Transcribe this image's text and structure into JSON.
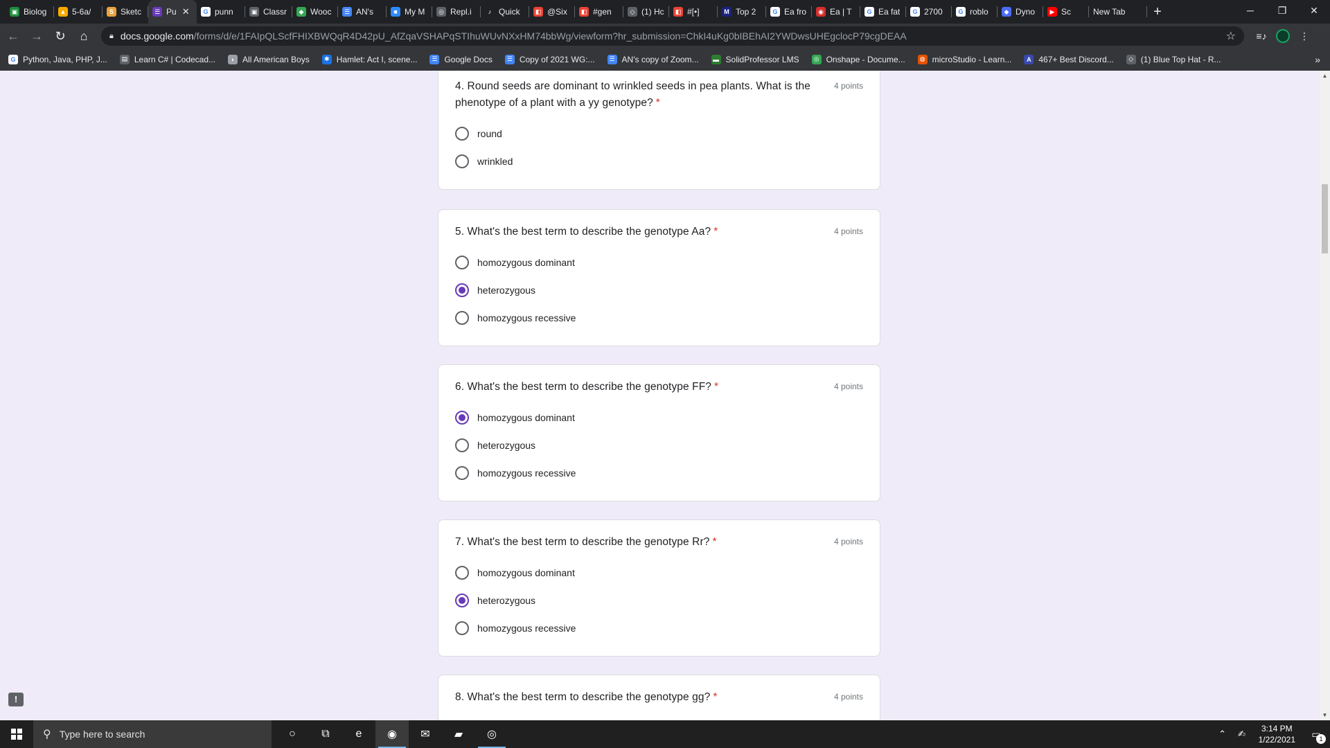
{
  "tabs": [
    {
      "title": "Biolog",
      "fav_color": "#1e8e3e",
      "fav_glyph": "▣"
    },
    {
      "title": "5-6a/",
      "fav_color": "#f9ab00",
      "fav_glyph": "▲"
    },
    {
      "title": "Sketc",
      "fav_color": "#e8a33d",
      "fav_glyph": "S"
    },
    {
      "title": "Pu",
      "fav_color": "#673ab7",
      "fav_glyph": "☰",
      "active": true
    },
    {
      "title": "punn",
      "fav_color": "#ffffff",
      "fav_glyph": "G"
    },
    {
      "title": "Classr",
      "fav_color": "#5f6368",
      "fav_glyph": "▣"
    },
    {
      "title": "Wooc",
      "fav_color": "#34a853",
      "fav_glyph": "◆"
    },
    {
      "title": "AN's",
      "fav_color": "#4285f4",
      "fav_glyph": "☰"
    },
    {
      "title": "My M",
      "fav_color": "#2d8cff",
      "fav_glyph": "■"
    },
    {
      "title": "Repl.i",
      "fav_color": "#5f6368",
      "fav_glyph": "◎"
    },
    {
      "title": "Quick",
      "fav_color": "#202124",
      "fav_glyph": "♪"
    },
    {
      "title": "@Six",
      "fav_color": "#ea4335",
      "fav_glyph": "◧"
    },
    {
      "title": "#gen",
      "fav_color": "#ea4335",
      "fav_glyph": "◧"
    },
    {
      "title": "(1) Hc",
      "fav_color": "#5f6368",
      "fav_glyph": "◇"
    },
    {
      "title": "#[•]",
      "fav_color": "#ea4335",
      "fav_glyph": "◧"
    },
    {
      "title": "Top 2",
      "fav_color": "#1a237e",
      "fav_glyph": "M"
    },
    {
      "title": "Ea fro",
      "fav_color": "#ffffff",
      "fav_glyph": "G"
    },
    {
      "title": "Ea | T",
      "fav_color": "#d32f2f",
      "fav_glyph": "◉"
    },
    {
      "title": "Ea fat",
      "fav_color": "#ffffff",
      "fav_glyph": "G"
    },
    {
      "title": "2700",
      "fav_color": "#ffffff",
      "fav_glyph": "G"
    },
    {
      "title": "roblo",
      "fav_color": "#ffffff",
      "fav_glyph": "G"
    },
    {
      "title": "Dyno",
      "fav_color": "#4a6cf7",
      "fav_glyph": "◆"
    },
    {
      "title": "Sc",
      "fav_color": "#ff0000",
      "fav_glyph": "▶"
    },
    {
      "title": "New Tab",
      "fav_color": "",
      "fav_glyph": ""
    }
  ],
  "window_controls": {
    "minimize": "─",
    "restore": "❐",
    "close": "✕"
  },
  "toolbar": {
    "url_domain": "docs.google.com",
    "url_path": "/forms/d/e/1FAIpQLScfFHIXBWQqR4D42pU_AfZqaVSHAPqSTIhuWUvNXxHM74bbWg/viewform?hr_submission=ChkI4uKg0bIBEhAI2YWDwsUHEgclocP79cgDEAA"
  },
  "bookmarks": [
    {
      "label": "Python, Java, PHP, J...",
      "color": "#ffffff",
      "glyph": "G"
    },
    {
      "label": "Learn C# | Codecad...",
      "color": "#5f6368",
      "glyph": "▤"
    },
    {
      "label": "All American Boys",
      "color": "#9aa0a6",
      "glyph": "◗"
    },
    {
      "label": "Hamlet: Act I, scene...",
      "color": "#1a73e8",
      "glyph": "✱"
    },
    {
      "label": "Google Docs",
      "color": "#4285f4",
      "glyph": "☰"
    },
    {
      "label": "Copy of 2021 WG:...",
      "color": "#4285f4",
      "glyph": "☰"
    },
    {
      "label": "AN's copy of Zoom...",
      "color": "#4285f4",
      "glyph": "☰"
    },
    {
      "label": "SolidProfessor LMS",
      "color": "#2e7d32",
      "glyph": "▬"
    },
    {
      "label": "Onshape - Docume...",
      "color": "#34a853",
      "glyph": "◎"
    },
    {
      "label": "microStudio - Learn...",
      "color": "#e65100",
      "glyph": "◍"
    },
    {
      "label": "467+ Best Discord...",
      "color": "#3949ab",
      "glyph": "A"
    },
    {
      "label": "(1) Blue Top Hat - R...",
      "color": "#5f6368",
      "glyph": "◇"
    }
  ],
  "questions": [
    {
      "title": "4. Round seeds are dominant to wrinkled seeds in pea plants. What is the phenotype of a plant with a yy genotype?",
      "points": "4 points",
      "required_mark": "*",
      "options": [
        {
          "label": "round",
          "checked": false
        },
        {
          "label": "wrinkled",
          "checked": false
        }
      ]
    },
    {
      "title": "5. What's the best term to describe the genotype Aa?",
      "points": "4 points",
      "required_mark": "*",
      "options": [
        {
          "label": "homozygous dominant",
          "checked": false
        },
        {
          "label": "heterozygous",
          "checked": true
        },
        {
          "label": "homozygous recessive",
          "checked": false
        }
      ]
    },
    {
      "title": "6. What's the best term to describe the genotype FF?",
      "points": "4 points",
      "required_mark": "*",
      "options": [
        {
          "label": "homozygous dominant",
          "checked": true
        },
        {
          "label": "heterozygous",
          "checked": false
        },
        {
          "label": "homozygous recessive",
          "checked": false
        }
      ]
    },
    {
      "title": "7. What's the best term to describe the genotype Rr?",
      "points": "4 points",
      "required_mark": "*",
      "options": [
        {
          "label": "homozygous dominant",
          "checked": false
        },
        {
          "label": "heterozygous",
          "checked": true
        },
        {
          "label": "homozygous recessive",
          "checked": false
        }
      ]
    },
    {
      "title": "8. What's the best term to describe the genotype gg?",
      "points": "4 points",
      "required_mark": "*",
      "options": []
    }
  ],
  "taskbar": {
    "search_placeholder": "Type here to search",
    "apps": [
      {
        "name": "cortana-icon",
        "glyph": "○",
        "running": false,
        "active": false
      },
      {
        "name": "task-view-icon",
        "glyph": "⧉",
        "running": false,
        "active": false
      },
      {
        "name": "edge-icon",
        "glyph": "e",
        "running": false,
        "active": false
      },
      {
        "name": "chrome-icon",
        "glyph": "◉",
        "running": true,
        "active": true
      },
      {
        "name": "mail-icon",
        "glyph": "✉",
        "running": false,
        "active": false
      },
      {
        "name": "file-explorer-icon",
        "glyph": "▰",
        "running": false,
        "active": false
      },
      {
        "name": "blender-icon",
        "glyph": "◎",
        "running": true,
        "active": false
      }
    ],
    "time": "3:14 PM",
    "date": "1/22/2021",
    "notification_count": "1"
  },
  "colors": {
    "accent": "#673ab7",
    "required": "#d93025",
    "page_bg": "#f0ebf8"
  }
}
